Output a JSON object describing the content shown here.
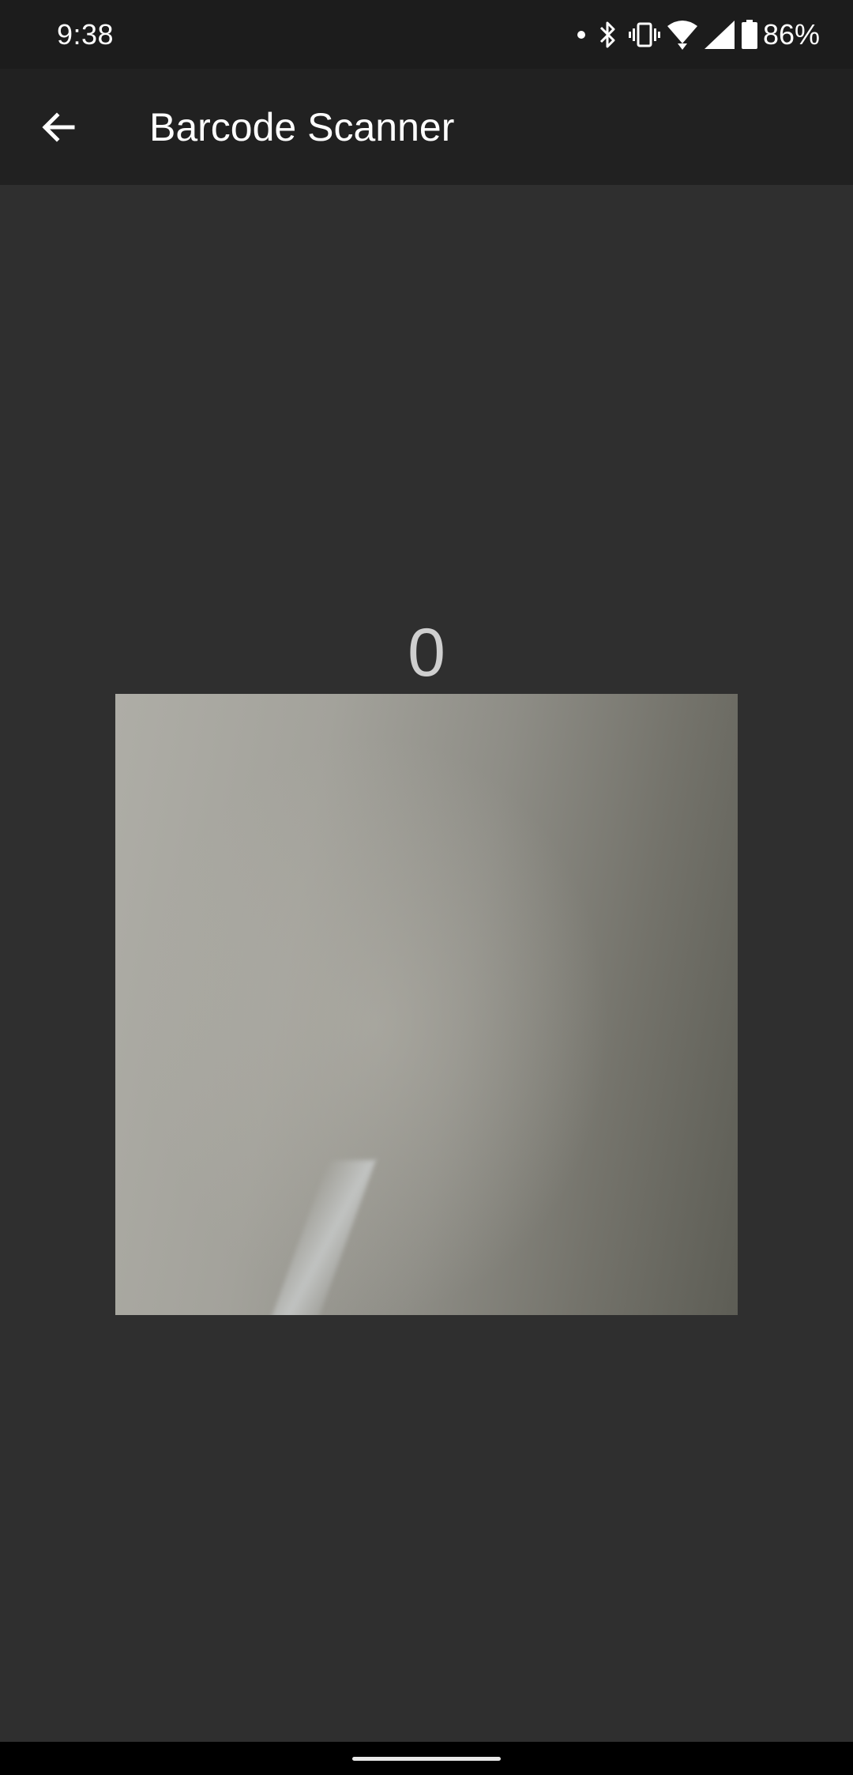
{
  "status_bar": {
    "time": "9:38",
    "battery_percent": "86%",
    "icons": [
      "notification-dot-icon",
      "bluetooth-icon",
      "vibrate-icon",
      "wifi-icon",
      "cell-signal-icon",
      "battery-icon"
    ]
  },
  "app_bar": {
    "back_icon": "arrow-back-icon",
    "title": "Barcode Scanner"
  },
  "scanner": {
    "count": "0"
  },
  "colors": {
    "background": "#2f2f2f",
    "app_bar": "#212121",
    "status_bar": "#1c1c1c",
    "counter_text": "#cfcfcf"
  }
}
